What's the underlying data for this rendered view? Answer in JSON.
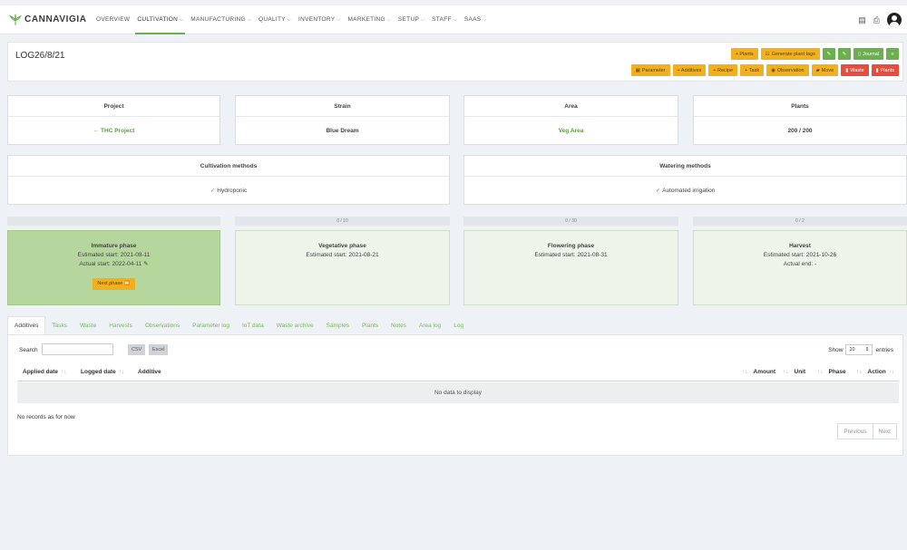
{
  "app": {
    "brand": "CANNAVIGIA"
  },
  "nav": {
    "items": [
      {
        "label": "OVERVIEW",
        "dropdown": false,
        "active": false
      },
      {
        "label": "CULTIVATION",
        "dropdown": true,
        "active": true
      },
      {
        "label": "MANUFACTURING",
        "dropdown": true,
        "active": false
      },
      {
        "label": "QUALITY",
        "dropdown": true,
        "active": false
      },
      {
        "label": "INVENTORY",
        "dropdown": true,
        "active": false
      },
      {
        "label": "MARKETING",
        "dropdown": true,
        "active": false
      },
      {
        "label": "SETUP",
        "dropdown": true,
        "active": false
      },
      {
        "label": "STAFF",
        "dropdown": true,
        "active": false
      },
      {
        "label": "SAAS",
        "dropdown": true,
        "active": false
      }
    ],
    "icons": [
      "list-icon",
      "print-icon",
      "avatar"
    ]
  },
  "header": {
    "title": "LOG26/8/21",
    "row1": [
      {
        "label": "+ Plants",
        "color": "yellow"
      },
      {
        "label": "Generate plant tags",
        "color": "yellow"
      },
      {
        "label": "",
        "color": "green"
      },
      {
        "label": "",
        "color": "green"
      },
      {
        "label": "Journal",
        "color": "green"
      },
      {
        "label": "",
        "color": "green"
      }
    ],
    "row2": [
      {
        "label": "Parameter",
        "color": "yellow"
      },
      {
        "label": "+ Additives",
        "color": "yellow"
      },
      {
        "label": "+ Recipe",
        "color": "yellow"
      },
      {
        "label": "+ Task",
        "color": "yellow"
      },
      {
        "label": "Observation",
        "color": "yellow"
      },
      {
        "label": "Move",
        "color": "yellow"
      },
      {
        "label": "Waste",
        "color": "red"
      },
      {
        "label": "Plants",
        "color": "red"
      }
    ]
  },
  "info": {
    "project": {
      "label": "Project",
      "value": "← THC Project"
    },
    "strain": {
      "label": "Strain",
      "value": "Blue Dream"
    },
    "area": {
      "label": "Area",
      "value": "Veg Area"
    },
    "plants": {
      "label": "Plants",
      "value": "200 / 200"
    },
    "cultivation": {
      "label": "Cultivation methods",
      "value": "Hydroponic"
    },
    "watering": {
      "label": "Watering methods",
      "value": "Automated irrigation"
    }
  },
  "phases": [
    {
      "bar": "",
      "title": "Immature phase",
      "line1": "Estimated start: 2021-08-11",
      "line2": "Actual start: 2022-04-11 ✎",
      "button": "Next phase ⏩"
    },
    {
      "bar": "0 / 10",
      "title": "Vegetative phase",
      "line1": "Estimated start: 2021-08-21",
      "line2": "",
      "button": ""
    },
    {
      "bar": "0 / 30",
      "title": "Flowering phase",
      "line1": "Estimated start: 2021-08-31",
      "line2": "",
      "button": ""
    },
    {
      "bar": "0 / 2",
      "title": "Harvest",
      "line1": "Estimated start: 2021-10-26",
      "line2": "Actual end: -",
      "button": ""
    }
  ],
  "tabs": [
    "Additives",
    "Tasks",
    "Waste",
    "Harvests",
    "Observations",
    "Parameter log",
    "IoT data",
    "Waste archive",
    "Samples",
    "Plants",
    "Notes",
    "Area log",
    "Log"
  ],
  "table": {
    "search_label": "Search",
    "export_csv": "CSV",
    "export_excel": "Excel",
    "show_label": "Show",
    "show_value": "10",
    "entries_label": "entries",
    "columns": [
      "Applied date",
      "Logged date",
      "Additive",
      "Amount",
      "Unit",
      "Phase",
      "Action"
    ],
    "empty": "No data to display",
    "records": "No records as for now",
    "prev": "Previous",
    "next": "Next"
  }
}
